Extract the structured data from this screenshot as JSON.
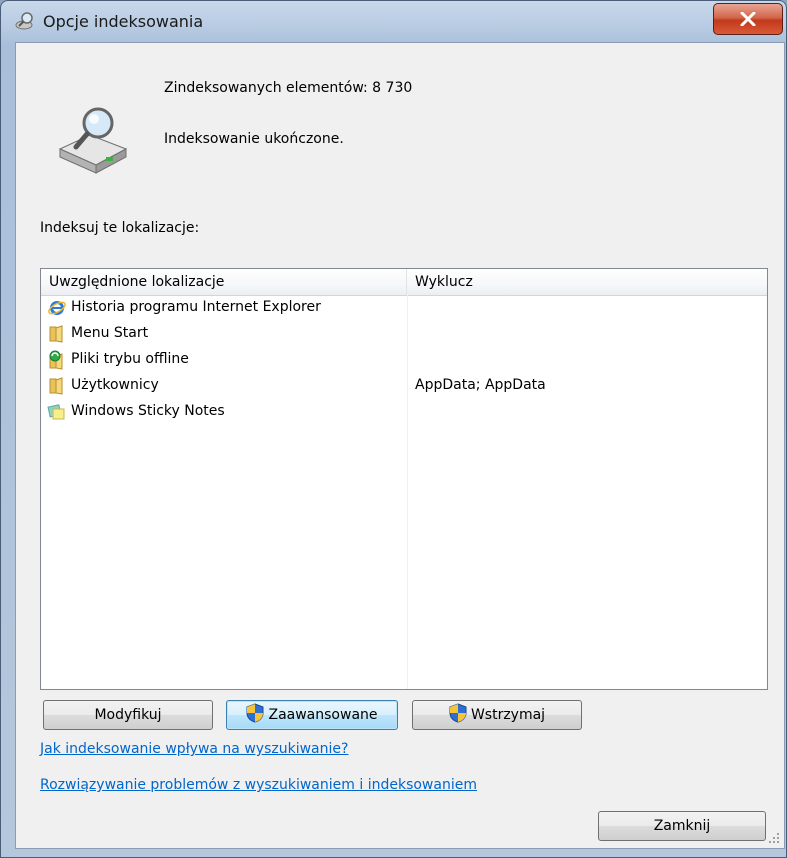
{
  "window": {
    "title": "Opcje indeksowania",
    "close_label": "X"
  },
  "status": {
    "indexed_items": "Zindeksowanych elementów: 8 730",
    "state": "Indeksowanie ukończone."
  },
  "locations_label": "Indeksuj te lokalizacje:",
  "table": {
    "columns": [
      "Uwzględnione lokalizacje",
      "Wyklucz"
    ],
    "rows": [
      {
        "name": "Historia programu Internet Explorer",
        "exclude": "",
        "icon": "internet-explorer-icon"
      },
      {
        "name": "Menu Start",
        "exclude": "",
        "icon": "folder-icon"
      },
      {
        "name": "Pliki trybu offline",
        "exclude": "",
        "icon": "offline-files-icon"
      },
      {
        "name": "Użytkownicy",
        "exclude": "AppData; AppData",
        "icon": "folder-icon"
      },
      {
        "name": "Windows Sticky Notes",
        "exclude": "",
        "icon": "sticky-notes-icon"
      }
    ]
  },
  "buttons": {
    "modify": "Modyfikuj",
    "advanced": "Zaawansowane",
    "pause": "Wstrzymaj",
    "close": "Zamknij"
  },
  "links": {
    "how_indexing_affects": "Jak indeksowanie wpływa na wyszukiwanie?",
    "troubleshoot": "Rozwiązywanie problemów z wyszukiwaniem i indeksowaniem"
  },
  "colors": {
    "link": "#0066cc",
    "close_button": "#c2391c",
    "title_bar": "#b7cbe2"
  }
}
